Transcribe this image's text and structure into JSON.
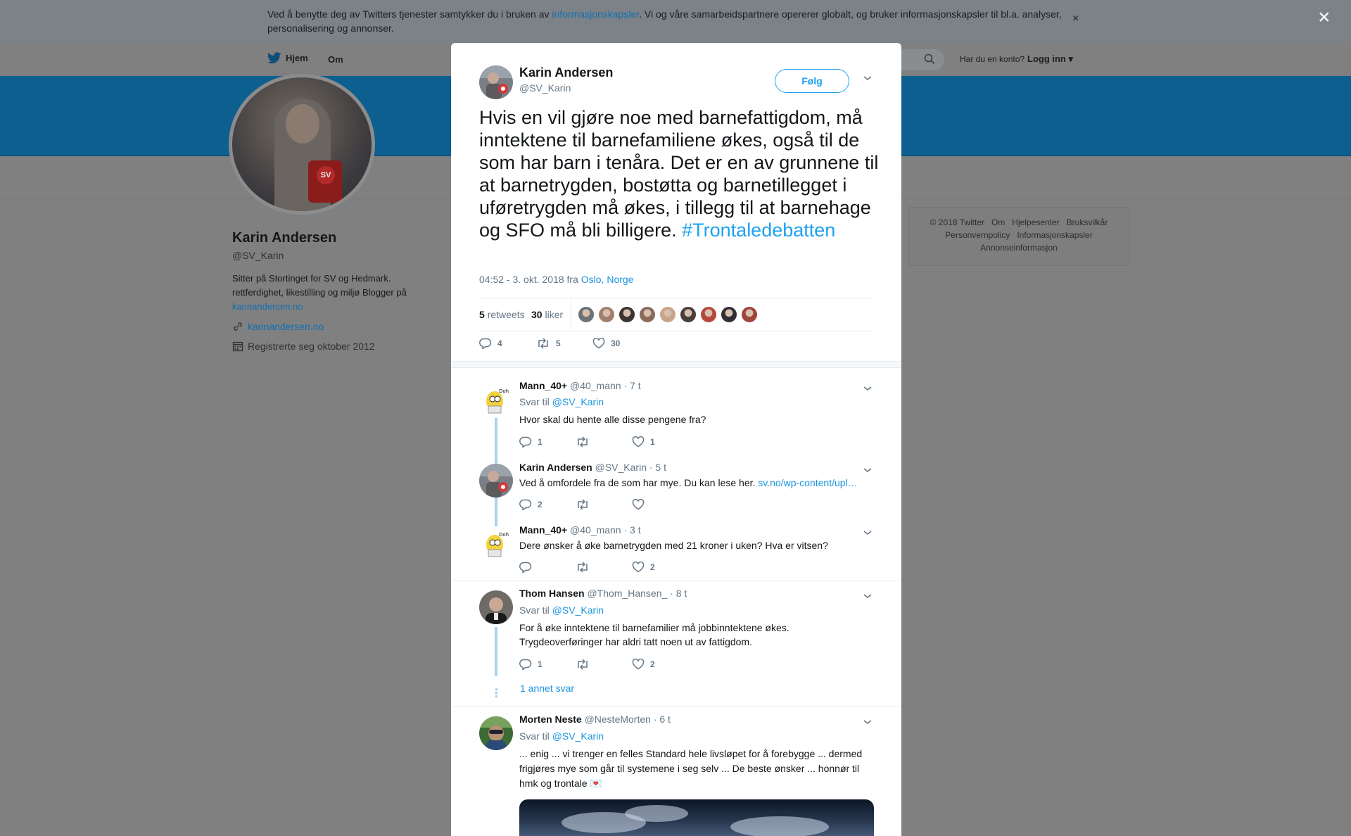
{
  "cookie_banner": {
    "text_before": "Ved å benytte deg av Twitters tjenester samtykker du i bruken av ",
    "link": "informasjonskapsler",
    "text_after": ". Vi og våre samarbeidspartnere opererer globalt, og bruker informasjonskapsler til bl.a. analyser, personalisering og annonser.",
    "close": "×"
  },
  "page_close": "×",
  "nav": {
    "home": "Hjem",
    "about": "Om",
    "account_question": "Har du en konto?",
    "login": "Logg inn"
  },
  "profile": {
    "name": "Karin Andersen",
    "handle": "@SV_Karin",
    "bio_text": "Sitter på Stortinget for SV og Hedmark. rettferdighet, likestilling og miljø Blogger på ",
    "bio_link": "karinandersen.no",
    "url": "karinandersen.no",
    "joined": "Registrerte seg oktober 2012"
  },
  "footer": {
    "links": [
      "© 2018 Twitter",
      "Om",
      "Hjelpesenter",
      "Bruksvilkår",
      "Personvernpolicy",
      "Informasjonskapsler",
      "Annonseinformasjon"
    ]
  },
  "tweet": {
    "author_name": "Karin Andersen",
    "author_handle": "@SV_Karin",
    "follow_label": "Følg",
    "text": "Hvis en vil gjøre noe med barnefattigdom, må inntektene  til barnefamiliene økes, også til de som har barn i tenåra. Det er en av grunnene til at barnetrygden, bostøtta og barnetillegget i uføretrygden må økes, i tillegg til at barnehage og SFO må bli billigere.",
    "hashtag": "#Trontaledebatten",
    "timestamp": "04:52 - 3. okt. 2018 fra",
    "location": "Oslo, Norge",
    "retweets_count": "5",
    "retweets_label": "retweets",
    "likes_count": "30",
    "likes_label": "liker",
    "replies": "4",
    "retweets": "5",
    "likes": "30",
    "liker_colors": [
      "#6d7276",
      "#a27f6b",
      "#3e3430",
      "#8a6a5a",
      "#c8a58a",
      "#4a3e3a",
      "#b5483a",
      "#2f2f35",
      "#a0443c"
    ]
  },
  "replies": [
    {
      "name": "Mann_40+",
      "handle": "@40_mann",
      "time": "· 7 t",
      "reply_to_prefix": "Svar til ",
      "reply_to": "@SV_Karin",
      "text": "Hvor skal du hente alle disse pengene fra?",
      "replies": "1",
      "retweets": "",
      "likes": "1"
    },
    {
      "name": "Karin Andersen",
      "handle": "@SV_Karin",
      "time": "· 5 t",
      "text": "Ved å omfordele fra de som har mye. Du kan lese her. ",
      "link": "sv.no/wp-content/upl…",
      "replies": "2",
      "retweets": "",
      "likes": ""
    },
    {
      "name": "Mann_40+",
      "handle": "@40_mann",
      "time": "· 3 t",
      "text": "Dere ønsker å øke barnetrygden med 21 kroner i uken? Hva er vitsen?",
      "replies": "",
      "retweets": "",
      "likes": "2"
    },
    {
      "name": "Thom Hansen",
      "handle": "@Thom_Hansen_",
      "time": "· 8 t",
      "reply_to_prefix": "Svar til ",
      "reply_to": "@SV_Karin",
      "text": "For å øke inntektene til barnefamilier må jobbinntektene økes. Trygdeoverføringer har aldri tatt noen ut av fattigdom.",
      "replies": "1",
      "retweets": "",
      "likes": "2",
      "more": "1 annet svar"
    },
    {
      "name": "Morten Neste",
      "handle": "@NesteMorten",
      "time": "· 6 t",
      "reply_to_prefix": "Svar til ",
      "reply_to": "@SV_Karin",
      "text": "... enig ... vi trenger en felles Standard hele livsløpet for å forebygge ... dermed frigjøres mye som går til systemene i seg selv ...  De beste ønsker ... honnør til hmk og trontale 💌"
    }
  ]
}
